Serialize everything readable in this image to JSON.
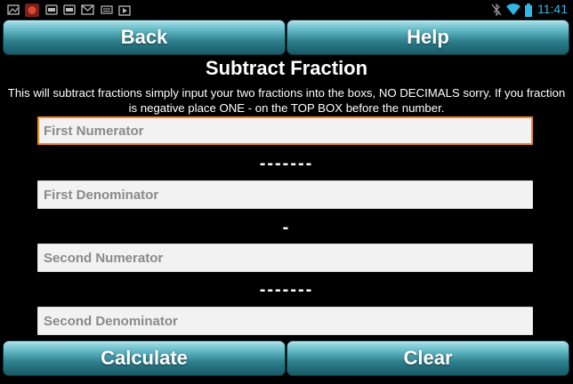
{
  "status_bar": {
    "time": "11:41",
    "left_icons": [
      "gallery-icon",
      "game-icon",
      "storage-icon",
      "storage-icon",
      "gmail-icon",
      "keyboard-icon",
      "play-store-icon"
    ],
    "right_icons": [
      "bluetooth-off-icon",
      "wifi-icon",
      "battery-icon"
    ]
  },
  "top_buttons": {
    "back": "Back",
    "help": "Help"
  },
  "title": "Subtract Fraction",
  "description": "This will subtract fractions simply input your two fractions into the boxs, NO DECIMALS sorry. If you fraction is negative place ONE - on the TOP BOX before  the number.",
  "fields": {
    "first_numerator": {
      "placeholder": "First Numerator",
      "value": ""
    },
    "first_denominator": {
      "placeholder": "First Denominator",
      "value": ""
    },
    "second_numerator": {
      "placeholder": "Second Numerator",
      "value": ""
    },
    "second_denominator": {
      "placeholder": "Second Denominator",
      "value": ""
    }
  },
  "separators": {
    "fraction_bar_1": "-------",
    "minus": "-",
    "fraction_bar_2": "-------"
  },
  "bottom_buttons": {
    "calculate": "Calculate",
    "clear": "Clear"
  },
  "colors": {
    "focus_border": "#f08a24",
    "button_teal": "#2d7e8c",
    "status_accent": "#33b5e5"
  }
}
